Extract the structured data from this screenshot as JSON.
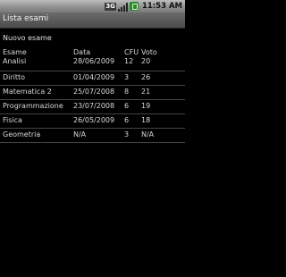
{
  "status_bar": {
    "network_label": "3G",
    "time": "11:53 AM",
    "colors": {
      "battery": "#2c8a2c"
    },
    "icons": [
      "3g-icon",
      "signal-icon",
      "battery-icon"
    ]
  },
  "title_bar": {
    "title": "Lista esami"
  },
  "main": {
    "new_exam_label": "Nuovo esame",
    "table": {
      "headers": {
        "name": "Esame",
        "date": "Data",
        "cfu": "CFU",
        "voto": "Voto"
      },
      "rows": [
        {
          "name": "Analisi",
          "date": "28/06/2009",
          "cfu": "12",
          "voto": "20"
        },
        {
          "name": "Diritto",
          "date": "01/04/2009",
          "cfu": "3",
          "voto": "26"
        },
        {
          "name": "Matematica 2",
          "date": "25/07/2008",
          "cfu": "8",
          "voto": "21"
        },
        {
          "name": "Programmazione",
          "date": "23/07/2008",
          "cfu": "6",
          "voto": "19"
        },
        {
          "name": "Fisica",
          "date": "26/05/2009",
          "cfu": "6",
          "voto": "18"
        },
        {
          "name": "Geometria",
          "date": "N/A",
          "cfu": "3",
          "voto": "N/A"
        }
      ]
    }
  }
}
